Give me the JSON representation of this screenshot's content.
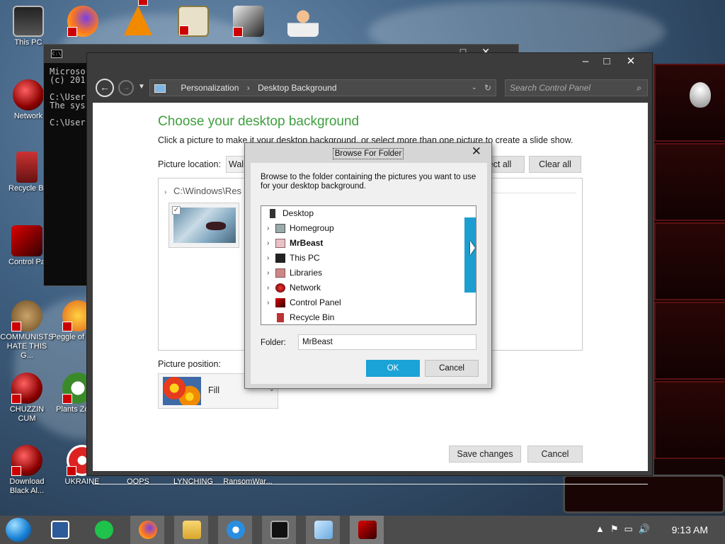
{
  "desktop": {
    "icons": [
      {
        "label": "This PC"
      },
      {
        "label": "Network"
      },
      {
        "label": "Recycle Bi"
      },
      {
        "label": "Control Pa"
      },
      {
        "label": "COMMUNISTS HATE THIS G..."
      },
      {
        "label": "Peggle of Warc"
      },
      {
        "label": "CHUZZIN CUM"
      },
      {
        "label": "Plants Zomb"
      },
      {
        "label": "Download Black Al..."
      },
      {
        "label": "UKRAINE"
      },
      {
        "label": "OOPS"
      },
      {
        "label": "LYNCHING"
      },
      {
        "label": "RansomWar..."
      }
    ]
  },
  "cmd": {
    "lines": "Microso\n(c) 201\n\nC:\\User\nThe sys\n\nC:\\User"
  },
  "control_panel": {
    "breadcrumb": [
      "Personalization",
      "Desktop Background"
    ],
    "search_placeholder": "Search Control Panel",
    "heading": "Choose your desktop background",
    "description": "Click a picture to make it your desktop background, or select more than one picture to create a slide show.",
    "picture_location_label": "Picture location:",
    "picture_location_value": "Wall",
    "select_all_label": "ect all",
    "clear_all_label": "Clear all",
    "folder_path": "C:\\Windows\\Res",
    "picture_position_label": "Picture position:",
    "picture_position_value": "Fill",
    "save_label": "Save changes",
    "cancel_label": "Cancel"
  },
  "browse_dialog": {
    "title": "Browse For Folder",
    "message": "Browse to the folder containing the pictures you want to use for your desktop background.",
    "tree": [
      {
        "label": "Desktop",
        "expandable": false,
        "bold": false
      },
      {
        "label": "Homegroup",
        "expandable": true,
        "bold": false
      },
      {
        "label": "MrBeast",
        "expandable": true,
        "bold": true
      },
      {
        "label": "This PC",
        "expandable": true,
        "bold": false
      },
      {
        "label": "Libraries",
        "expandable": true,
        "bold": false
      },
      {
        "label": "Network",
        "expandable": true,
        "bold": false
      },
      {
        "label": "Control Panel",
        "expandable": true,
        "bold": false
      },
      {
        "label": "Recycle Bin",
        "expandable": false,
        "bold": false
      }
    ],
    "folder_label": "Folder:",
    "folder_value": "MrBeast",
    "ok_label": "OK",
    "cancel_label": "Cancel"
  },
  "taskbar": {
    "time": "9:13 AM"
  },
  "colors": {
    "heading_green": "#3e9f3e",
    "accent_blue": "#1aa3d6"
  }
}
